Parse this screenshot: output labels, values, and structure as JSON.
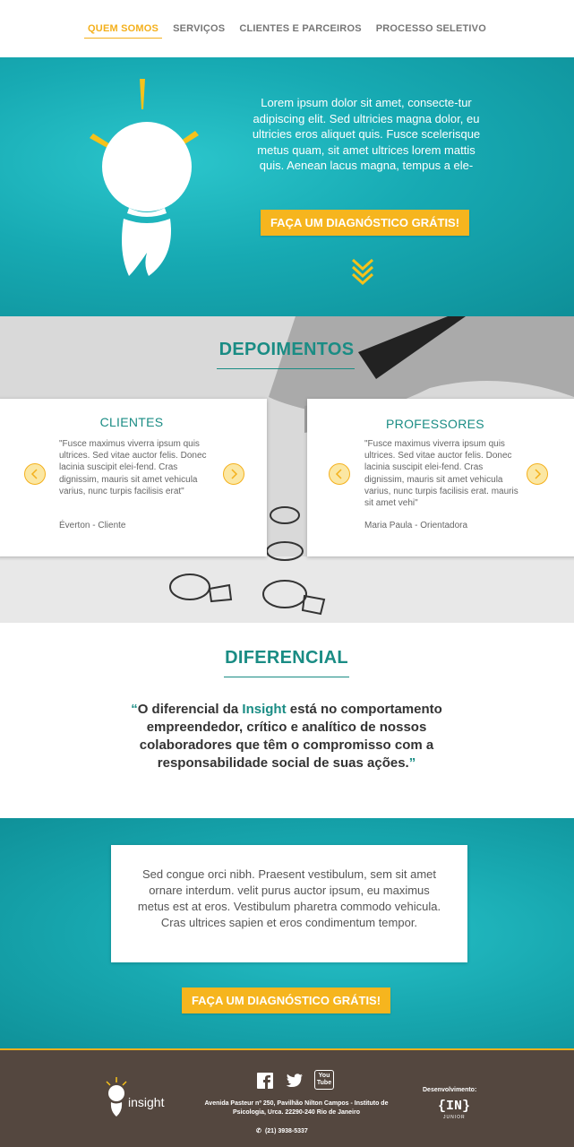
{
  "nav": {
    "items": [
      {
        "label": "QUEM SOMOS",
        "active": true
      },
      {
        "label": "SERVIÇOS",
        "active": false
      },
      {
        "label": "CLIENTES E PARCEIROS",
        "active": false
      },
      {
        "label": "PROCESSO SELETIVO",
        "active": false
      }
    ]
  },
  "hero": {
    "text": "Lorem ipsum dolor sit amet, consecte-tur adipiscing elit. Sed ultricies magna dolor, eu ultricies eros aliquet quis. Fusce scelerisque metus quam, sit amet ultrices lorem mattis quis. Aenean lacus magna, tempus a ele-",
    "cta_label": "FAÇA UM DIAGNÓSTICO GRÁTIS!",
    "icon": "lightbulb-rocket-icon",
    "scroll_icon": "double-chevron-down-icon"
  },
  "testimonials": {
    "title": "DEPOIMENTOS",
    "cards": [
      {
        "title": "CLIENTES",
        "quote": "\"Fusce maximus viverra ipsum quis ultrices. Sed vitae auctor felis. Donec lacinia suscipit elei-fend. Cras dignissim, mauris sit amet vehicula varius, nunc turpis facilisis erat\"",
        "author": "Éverton - Cliente"
      },
      {
        "title": "PROFESSORES",
        "quote": "\"Fusce maximus viverra ipsum quis ultrices. Sed vitae auctor felis. Donec lacinia suscipit elei-fend. Cras dignissim, mauris sit amet vehicula varius, nunc turpis facilisis erat. mauris sit amet vehi\"",
        "author": "Maria Paula - Orientadora"
      }
    ]
  },
  "diferencial": {
    "title": "DIFERENCIAL",
    "quote_open": "“",
    "quote_pre": "O diferencial da ",
    "brand": "Insight",
    "quote_post": " está no comportamento empreendedor, crítico e analítico de nossos colaboradores que têm o compromisso com a responsabilidade social de suas ações.",
    "quote_close": "”"
  },
  "lower": {
    "text": "Sed congue orci nibh. Praesent vestibulum, sem sit amet ornare interdum. velit purus auctor ipsum, eu maximus metus est at eros. Vestibulum pharetra commodo vehicula. Cras ultrices sapien et eros condimentum tempor.",
    "cta_label": "FAÇA UM DIAGNÓSTICO GRÁTIS!"
  },
  "footer": {
    "logo_text": "insight",
    "social": [
      "facebook-icon",
      "twitter-icon",
      "youtube-icon"
    ],
    "youtube_label": "You Tube",
    "address": "Avenida Pasteur nº 250, Pavilhão Nilton Campos - Instituto de Psicologia, Urca. 22290-240 Rio de Janeiro",
    "phone": "(21) 3938-5337",
    "dev_label": "Desenvolvimento:",
    "dev_logo": "{IN}",
    "dev_sub": "JUNIOR"
  },
  "colors": {
    "accent": "#f4b01c",
    "teal": "#17aab3",
    "heading": "#1a8c84",
    "footer_bg": "#54473f"
  }
}
